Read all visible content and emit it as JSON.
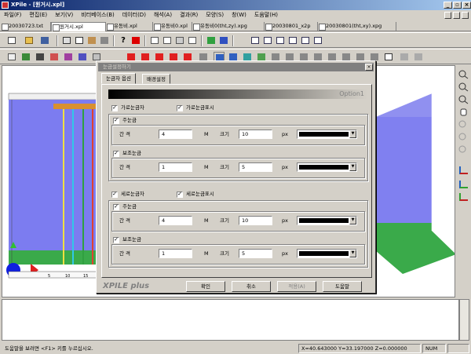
{
  "window": {
    "title": "XPile - [원거시.xpl]",
    "minimize": "_",
    "restore": "▫",
    "close": "×"
  },
  "menu": [
    "파일(F)",
    "편집(E)",
    "보기(V)",
    "비터베이스(B)",
    "데이터(D)",
    "해석(A)",
    "결과(R)",
    "모양(S)",
    "창(W)",
    "도움말(H)"
  ],
  "doc_tabs": [
    "20030723.txt",
    "원거시.xpl",
    "유동비.xpl",
    "유동비0.xpl",
    "유동비0(tht,zy).xpg",
    "20030801_x2p",
    "20030801(tht,xy).xpg"
  ],
  "status": {
    "help": "도움말을 보려면 <F1> 키를 누르십시오.",
    "coords": "X=40.643000 Y=33.197000 Z=0.000000",
    "num": "NUM"
  },
  "dialog": {
    "title": "눈금설정하기",
    "close": "×",
    "tabs": [
      "눈금자 옵션",
      "배경설정"
    ],
    "option_label": "Option1",
    "horizontal": {
      "ruler_label": "가로눈금자",
      "show_label": "가로눈금표시",
      "major": {
        "label": "주눈금",
        "interval_label": "간 격",
        "interval": "4",
        "unit": "M",
        "size_label": "크기",
        "size": "10",
        "size_unit": "px"
      },
      "minor": {
        "label": "보조눈금",
        "interval_label": "간 격",
        "interval": "1",
        "unit": "M",
        "size_label": "크기",
        "size": "5",
        "size_unit": "px"
      }
    },
    "vertical": {
      "ruler_label": "세로눈금자",
      "show_label": "세로눈금표시",
      "major": {
        "label": "주눈금",
        "interval_label": "간 격",
        "interval": "4",
        "unit": "M",
        "size_label": "크기",
        "size": "10",
        "size_unit": "px"
      },
      "minor": {
        "label": "보조눈금",
        "interval_label": "간 격",
        "interval": "1",
        "unit": "M",
        "size_label": "크기",
        "size": "5",
        "size_unit": "px"
      }
    },
    "brand": "XPILE plus",
    "buttons": {
      "ok": "확인",
      "cancel": "취소",
      "apply": "적용(A)",
      "help": "도움말"
    }
  },
  "ruler_ticks": [
    "5",
    "10",
    "15"
  ],
  "colors": {
    "ground": "#3aaa4a",
    "soil": "#7c7cf0",
    "pile_yellow": "#f0e040",
    "pile_cyan": "#30c8e8",
    "pile_green": "#30a040",
    "cap": "#d89030"
  }
}
